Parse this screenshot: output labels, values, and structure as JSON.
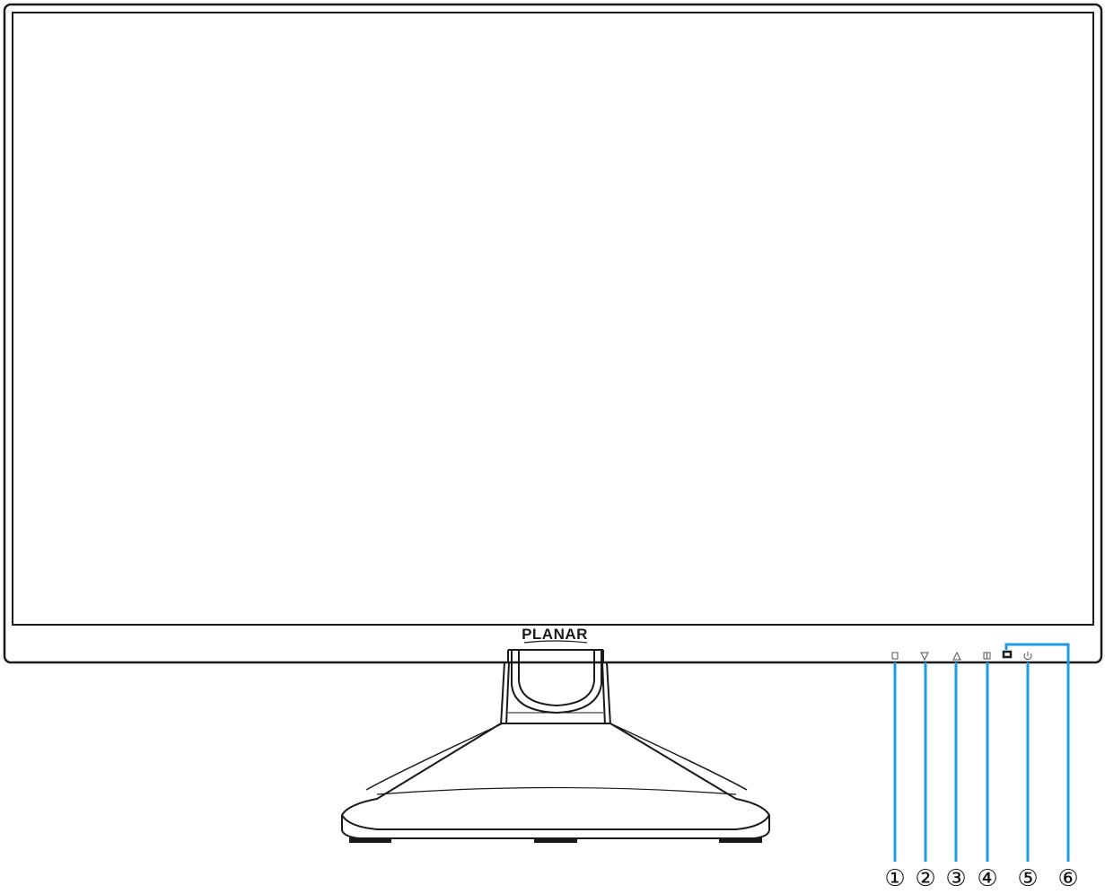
{
  "brand": {
    "logo_text": "PLANAR"
  },
  "colors": {
    "outline": "#1a1a1a",
    "leader": "#1f9be6",
    "background": "#ffffff"
  },
  "buttons": [
    {
      "id": 1,
      "icon": "menu-square-icon",
      "symbol": "□"
    },
    {
      "id": 2,
      "icon": "down-triangle-icon",
      "symbol": "▽"
    },
    {
      "id": 3,
      "icon": "up-triangle-icon",
      "symbol": "△"
    },
    {
      "id": 4,
      "icon": "input-source-icon",
      "symbol": "⊞"
    },
    {
      "id": 5,
      "icon": "power-icon",
      "symbol": "⏻"
    },
    {
      "id": 6,
      "icon": "power-led-icon",
      "symbol": ""
    }
  ],
  "callouts": [
    "①",
    "②",
    "③",
    "④",
    "⑤",
    "⑥"
  ]
}
